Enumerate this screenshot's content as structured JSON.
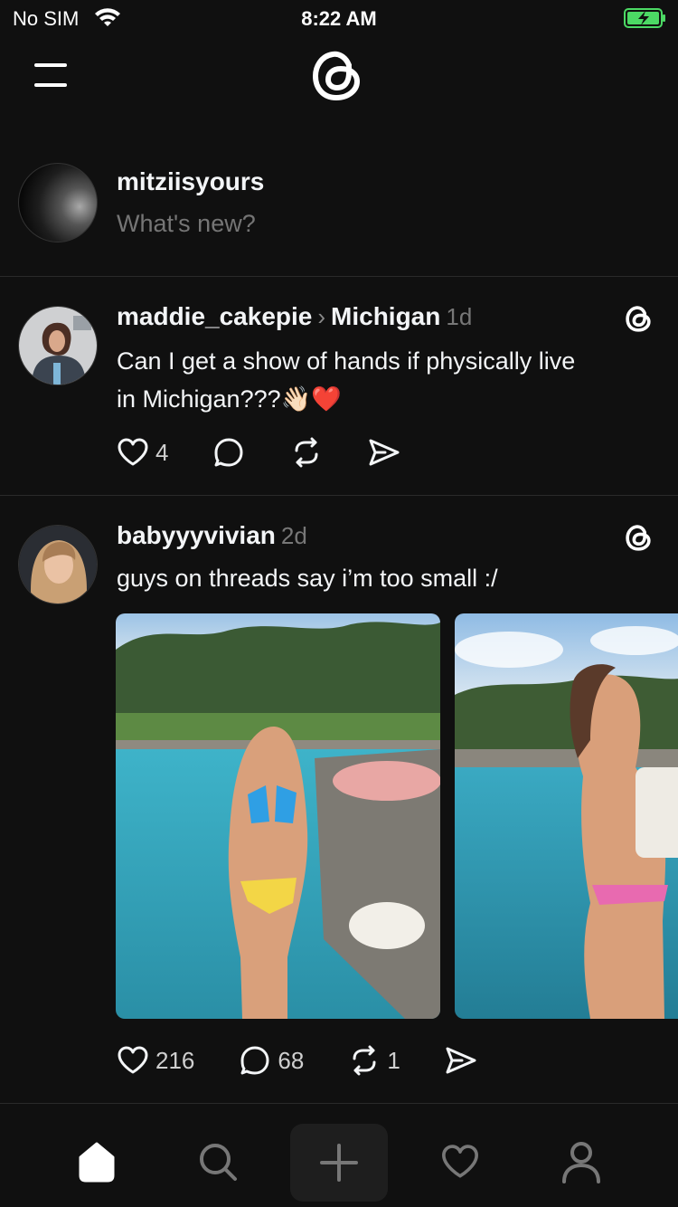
{
  "status_bar": {
    "carrier": "No SIM",
    "time": "8:22 AM",
    "battery": "charging"
  },
  "composer": {
    "username": "mitziisyours",
    "placeholder": "What's new?"
  },
  "posts": [
    {
      "username": "maddie_cakepie",
      "community": "Michigan",
      "time": "1d",
      "text_line1": "Can I get a show of hands if physically live",
      "text_line2": "in Michigan???👋🏻❤️",
      "likes": "4",
      "replies": "",
      "reposts": ""
    },
    {
      "username": "babyyyvivian",
      "time": "2d",
      "text": "guys on threads say i’m too small :/",
      "likes": "216",
      "replies": "68",
      "reposts": "1"
    }
  ],
  "tabbar": {
    "active": "home"
  },
  "colors": {
    "background": "#101010",
    "text": "#f3f5f7",
    "muted": "#777777",
    "divider": "#2a2a2a"
  }
}
